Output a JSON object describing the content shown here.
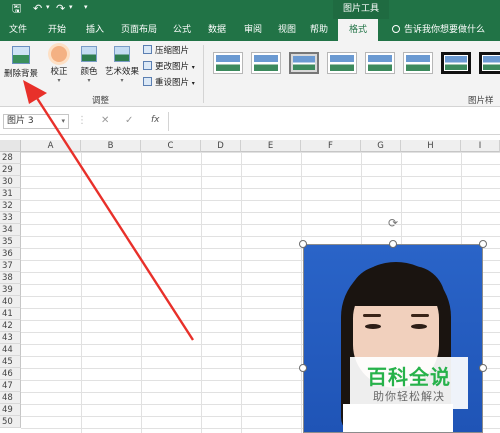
{
  "titlebar": {
    "context_tab_group": "图片工具",
    "accent_color": "#217346"
  },
  "tabs": [
    {
      "label": "文件"
    },
    {
      "label": "开始"
    },
    {
      "label": "插入"
    },
    {
      "label": "页面布局"
    },
    {
      "label": "公式"
    },
    {
      "label": "数据"
    },
    {
      "label": "审阅"
    },
    {
      "label": "视图"
    },
    {
      "label": "帮助"
    },
    {
      "label": "格式",
      "active": true
    }
  ],
  "tell_me": "告诉我你想要做什么",
  "ribbon": {
    "remove_background": "删除背景",
    "corrections": "校正",
    "color": "颜色",
    "artistic_effects": "艺术效果",
    "compress_pictures": "压缩图片",
    "change_picture": "更改图片",
    "reset_picture": "重设图片",
    "adjust_group": "调整",
    "picture_styles_group": "图片样式"
  },
  "formula_bar": {
    "name_box": "图片 3",
    "cancel": "✕",
    "enter": "✓",
    "fx": "fx",
    "formula": ""
  },
  "grid": {
    "columns": [
      "A",
      "B",
      "C",
      "D",
      "E",
      "F",
      "G",
      "H",
      "I"
    ],
    "rows": [
      "28",
      "29",
      "30",
      "31",
      "32",
      "33",
      "34",
      "35",
      "36",
      "37",
      "38",
      "39",
      "40",
      "41",
      "42",
      "43",
      "44",
      "45",
      "46",
      "47",
      "48",
      "49",
      "50"
    ]
  },
  "watermark": {
    "title": "百科全说",
    "subtitle": "助你轻松解决"
  },
  "annotation_arrow_color": "#e8302a"
}
